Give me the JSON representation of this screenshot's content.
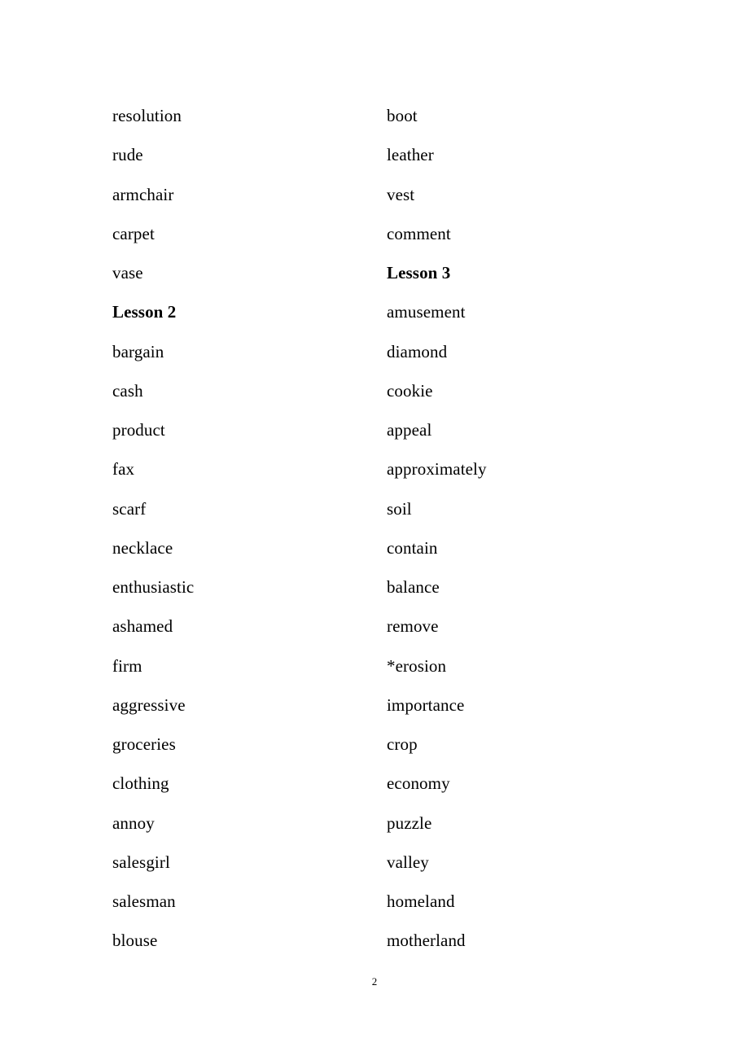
{
  "document": {
    "page_number": "2",
    "columns": [
      {
        "id": "left",
        "entries": [
          {
            "text": "resolution",
            "type": "word"
          },
          {
            "text": "rude",
            "type": "word"
          },
          {
            "text": "armchair",
            "type": "word"
          },
          {
            "text": "carpet",
            "type": "word"
          },
          {
            "text": "vase",
            "type": "word"
          },
          {
            "text": "Lesson 2",
            "type": "heading"
          },
          {
            "text": "bargain",
            "type": "word"
          },
          {
            "text": "cash",
            "type": "word"
          },
          {
            "text": "product",
            "type": "word"
          },
          {
            "text": "fax",
            "type": "word"
          },
          {
            "text": "scarf",
            "type": "word"
          },
          {
            "text": "necklace",
            "type": "word"
          },
          {
            "text": "enthusiastic",
            "type": "word"
          },
          {
            "text": "ashamed",
            "type": "word"
          },
          {
            "text": "firm",
            "type": "word"
          },
          {
            "text": "aggressive",
            "type": "word"
          },
          {
            "text": "groceries",
            "type": "word"
          },
          {
            "text": "clothing",
            "type": "word"
          },
          {
            "text": "annoy",
            "type": "word"
          },
          {
            "text": "salesgirl",
            "type": "word"
          },
          {
            "text": "salesman",
            "type": "word"
          },
          {
            "text": "blouse",
            "type": "word"
          }
        ]
      },
      {
        "id": "right",
        "entries": [
          {
            "text": "boot",
            "type": "word"
          },
          {
            "text": "leather",
            "type": "word"
          },
          {
            "text": "vest",
            "type": "word"
          },
          {
            "text": "comment",
            "type": "word"
          },
          {
            "text": "Lesson 3",
            "type": "heading"
          },
          {
            "text": "amusement",
            "type": "word"
          },
          {
            "text": "diamond",
            "type": "word"
          },
          {
            "text": "cookie",
            "type": "word"
          },
          {
            "text": "appeal",
            "type": "word"
          },
          {
            "text": "approximately",
            "type": "word"
          },
          {
            "text": "soil",
            "type": "word"
          },
          {
            "text": "contain",
            "type": "word"
          },
          {
            "text": "balance",
            "type": "word"
          },
          {
            "text": "remove",
            "type": "word"
          },
          {
            "text": "*erosion",
            "type": "word"
          },
          {
            "text": "importance",
            "type": "word"
          },
          {
            "text": "crop",
            "type": "word"
          },
          {
            "text": "economy",
            "type": "word"
          },
          {
            "text": "puzzle",
            "type": "word"
          },
          {
            "text": "valley",
            "type": "word"
          },
          {
            "text": "homeland",
            "type": "word"
          },
          {
            "text": "motherland",
            "type": "word"
          }
        ]
      }
    ]
  }
}
